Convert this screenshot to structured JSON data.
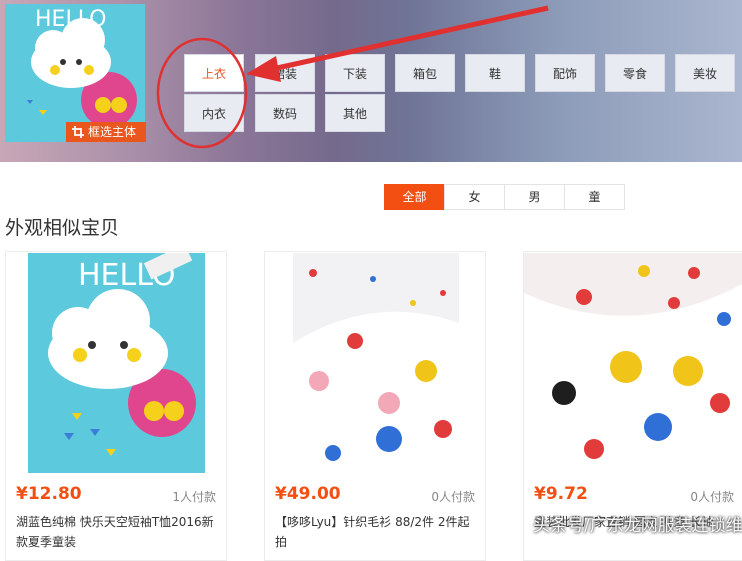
{
  "query_image": {
    "crop_button_label": "框选主体"
  },
  "categories": [
    {
      "label": "上衣",
      "active": true
    },
    {
      "label": "裙装",
      "active": false
    },
    {
      "label": "下装",
      "active": false
    },
    {
      "label": "箱包",
      "active": false
    },
    {
      "label": "鞋",
      "active": false
    },
    {
      "label": "配饰",
      "active": false
    },
    {
      "label": "零食",
      "active": false
    },
    {
      "label": "美妆",
      "active": false
    },
    {
      "label": "内衣",
      "active": false
    },
    {
      "label": "数码",
      "active": false
    },
    {
      "label": "其他",
      "active": false
    }
  ],
  "filter_tabs": [
    {
      "label": "全部",
      "active": true
    },
    {
      "label": "女",
      "active": false
    },
    {
      "label": "男",
      "active": false
    },
    {
      "label": "童",
      "active": false
    }
  ],
  "section_title": "外观相似宝贝",
  "products": [
    {
      "price": "¥12.80",
      "buyers": "1人付款",
      "title": "湖蓝色纯棉 快乐天空短袖T恤2016新款夏季童装"
    },
    {
      "price": "¥49.00",
      "buyers": "0人付款",
      "title": "【哆哆Lyu】针织毛衫 88/2件 2件起拍"
    },
    {
      "price": "¥9.72",
      "buyers": "0人付款",
      "title": "童装批发厂家直销 圆点 儿童 长袖"
    }
  ],
  "watermark": "头条号/广东龙网服装连锁维",
  "colors": {
    "accent": "#f34f13",
    "annotation": "#e03030"
  }
}
